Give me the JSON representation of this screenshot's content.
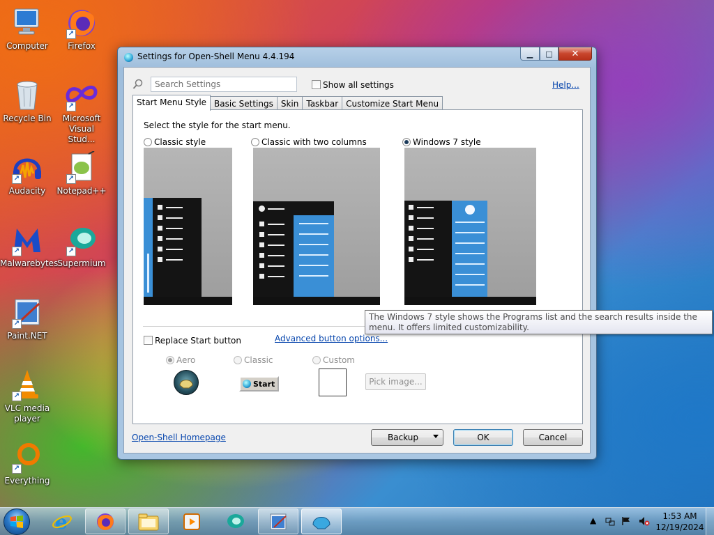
{
  "desktop": {
    "icons": [
      {
        "label": "Computer"
      },
      {
        "label": "Firefox"
      },
      {
        "label": "Recycle Bin"
      },
      {
        "label": "Microsoft Visual Stud..."
      },
      {
        "label": "Audacity"
      },
      {
        "label": "Notepad++"
      },
      {
        "label": "Malwarebytes"
      },
      {
        "label": "Supermium"
      },
      {
        "label": "Paint.NET"
      },
      {
        "label": "VLC media player"
      },
      {
        "label": "Everything"
      }
    ]
  },
  "window": {
    "title": "Settings for Open-Shell Menu 4.4.194",
    "search_placeholder": "Search Settings",
    "show_all_label": "Show all settings",
    "help_label": "Help...",
    "tabs": [
      {
        "label": "Start Menu Style",
        "active": true
      },
      {
        "label": "Basic Settings"
      },
      {
        "label": "Skin"
      },
      {
        "label": "Taskbar"
      },
      {
        "label": "Customize Start Menu"
      }
    ],
    "prompt": "Select the style for the start menu.",
    "styles": [
      {
        "label": "Classic style",
        "selected": false
      },
      {
        "label": "Classic with two columns",
        "selected": false
      },
      {
        "label": "Windows 7 style",
        "selected": true
      }
    ],
    "replace_start_label": "Replace Start button",
    "advanced_button_label": "Advanced button options...",
    "button_options": [
      {
        "label": "Aero",
        "selected": true
      },
      {
        "label": "Classic",
        "selected": false
      },
      {
        "label": "Custom",
        "selected": false
      }
    ],
    "classic_button_text": "Start",
    "pick_image_label": "Pick image...",
    "homepage_label": "Open-Shell Homepage",
    "backup_label": "Backup",
    "ok_label": "OK",
    "cancel_label": "Cancel"
  },
  "tooltip": {
    "text": "The Windows 7 style shows the Programs list and the search results inside the menu. It offers limited customizability."
  },
  "taskbar": {
    "apps": [
      "internet-explorer",
      "firefox",
      "file-explorer",
      "media-player",
      "supermium",
      "paint-net",
      "open-shell-settings"
    ],
    "clock_time": "1:53 AM",
    "clock_date": "12/19/2024"
  },
  "colors": {
    "accent_blue": "#3a8fd6",
    "menu_dark": "#141414",
    "link": "#0645ad"
  }
}
